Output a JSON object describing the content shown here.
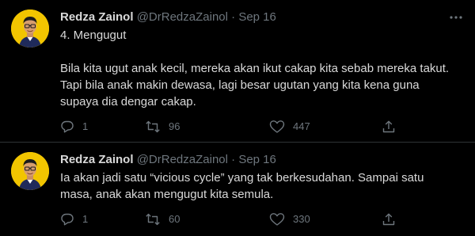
{
  "tweets": [
    {
      "author_name": "Redza Zainol",
      "handle": "@DrRedzaZainol",
      "separator": "·",
      "date": "Sep 16",
      "more_icon": "ellipsis-icon",
      "lines": [
        "4. Mengugut",
        "",
        "Bila kita ugut anak kecil, mereka akan ikut cakap kita sebab mereka takut.",
        "Tapi bila anak makin dewasa, lagi besar ugutan yang kita kena guna",
        "supaya dia dengar cakap."
      ],
      "replies": "1",
      "retweets": "96",
      "likes": "447"
    },
    {
      "author_name": "Redza Zainol",
      "handle": "@DrRedzaZainol",
      "separator": "·",
      "date": "Sep 16",
      "lines": [
        "Ia akan jadi satu “vicious cycle” yang tak berkesudahan. Sampai satu",
        "masa, anak akan mengugut kita semula."
      ],
      "replies": "1",
      "retweets": "60",
      "likes": "330"
    }
  ],
  "colors": {
    "background": "#000000",
    "text": "#d9d9d9",
    "secondary": "#6e767d",
    "divider": "#2f3336",
    "avatar_bg": "#f2c500"
  }
}
